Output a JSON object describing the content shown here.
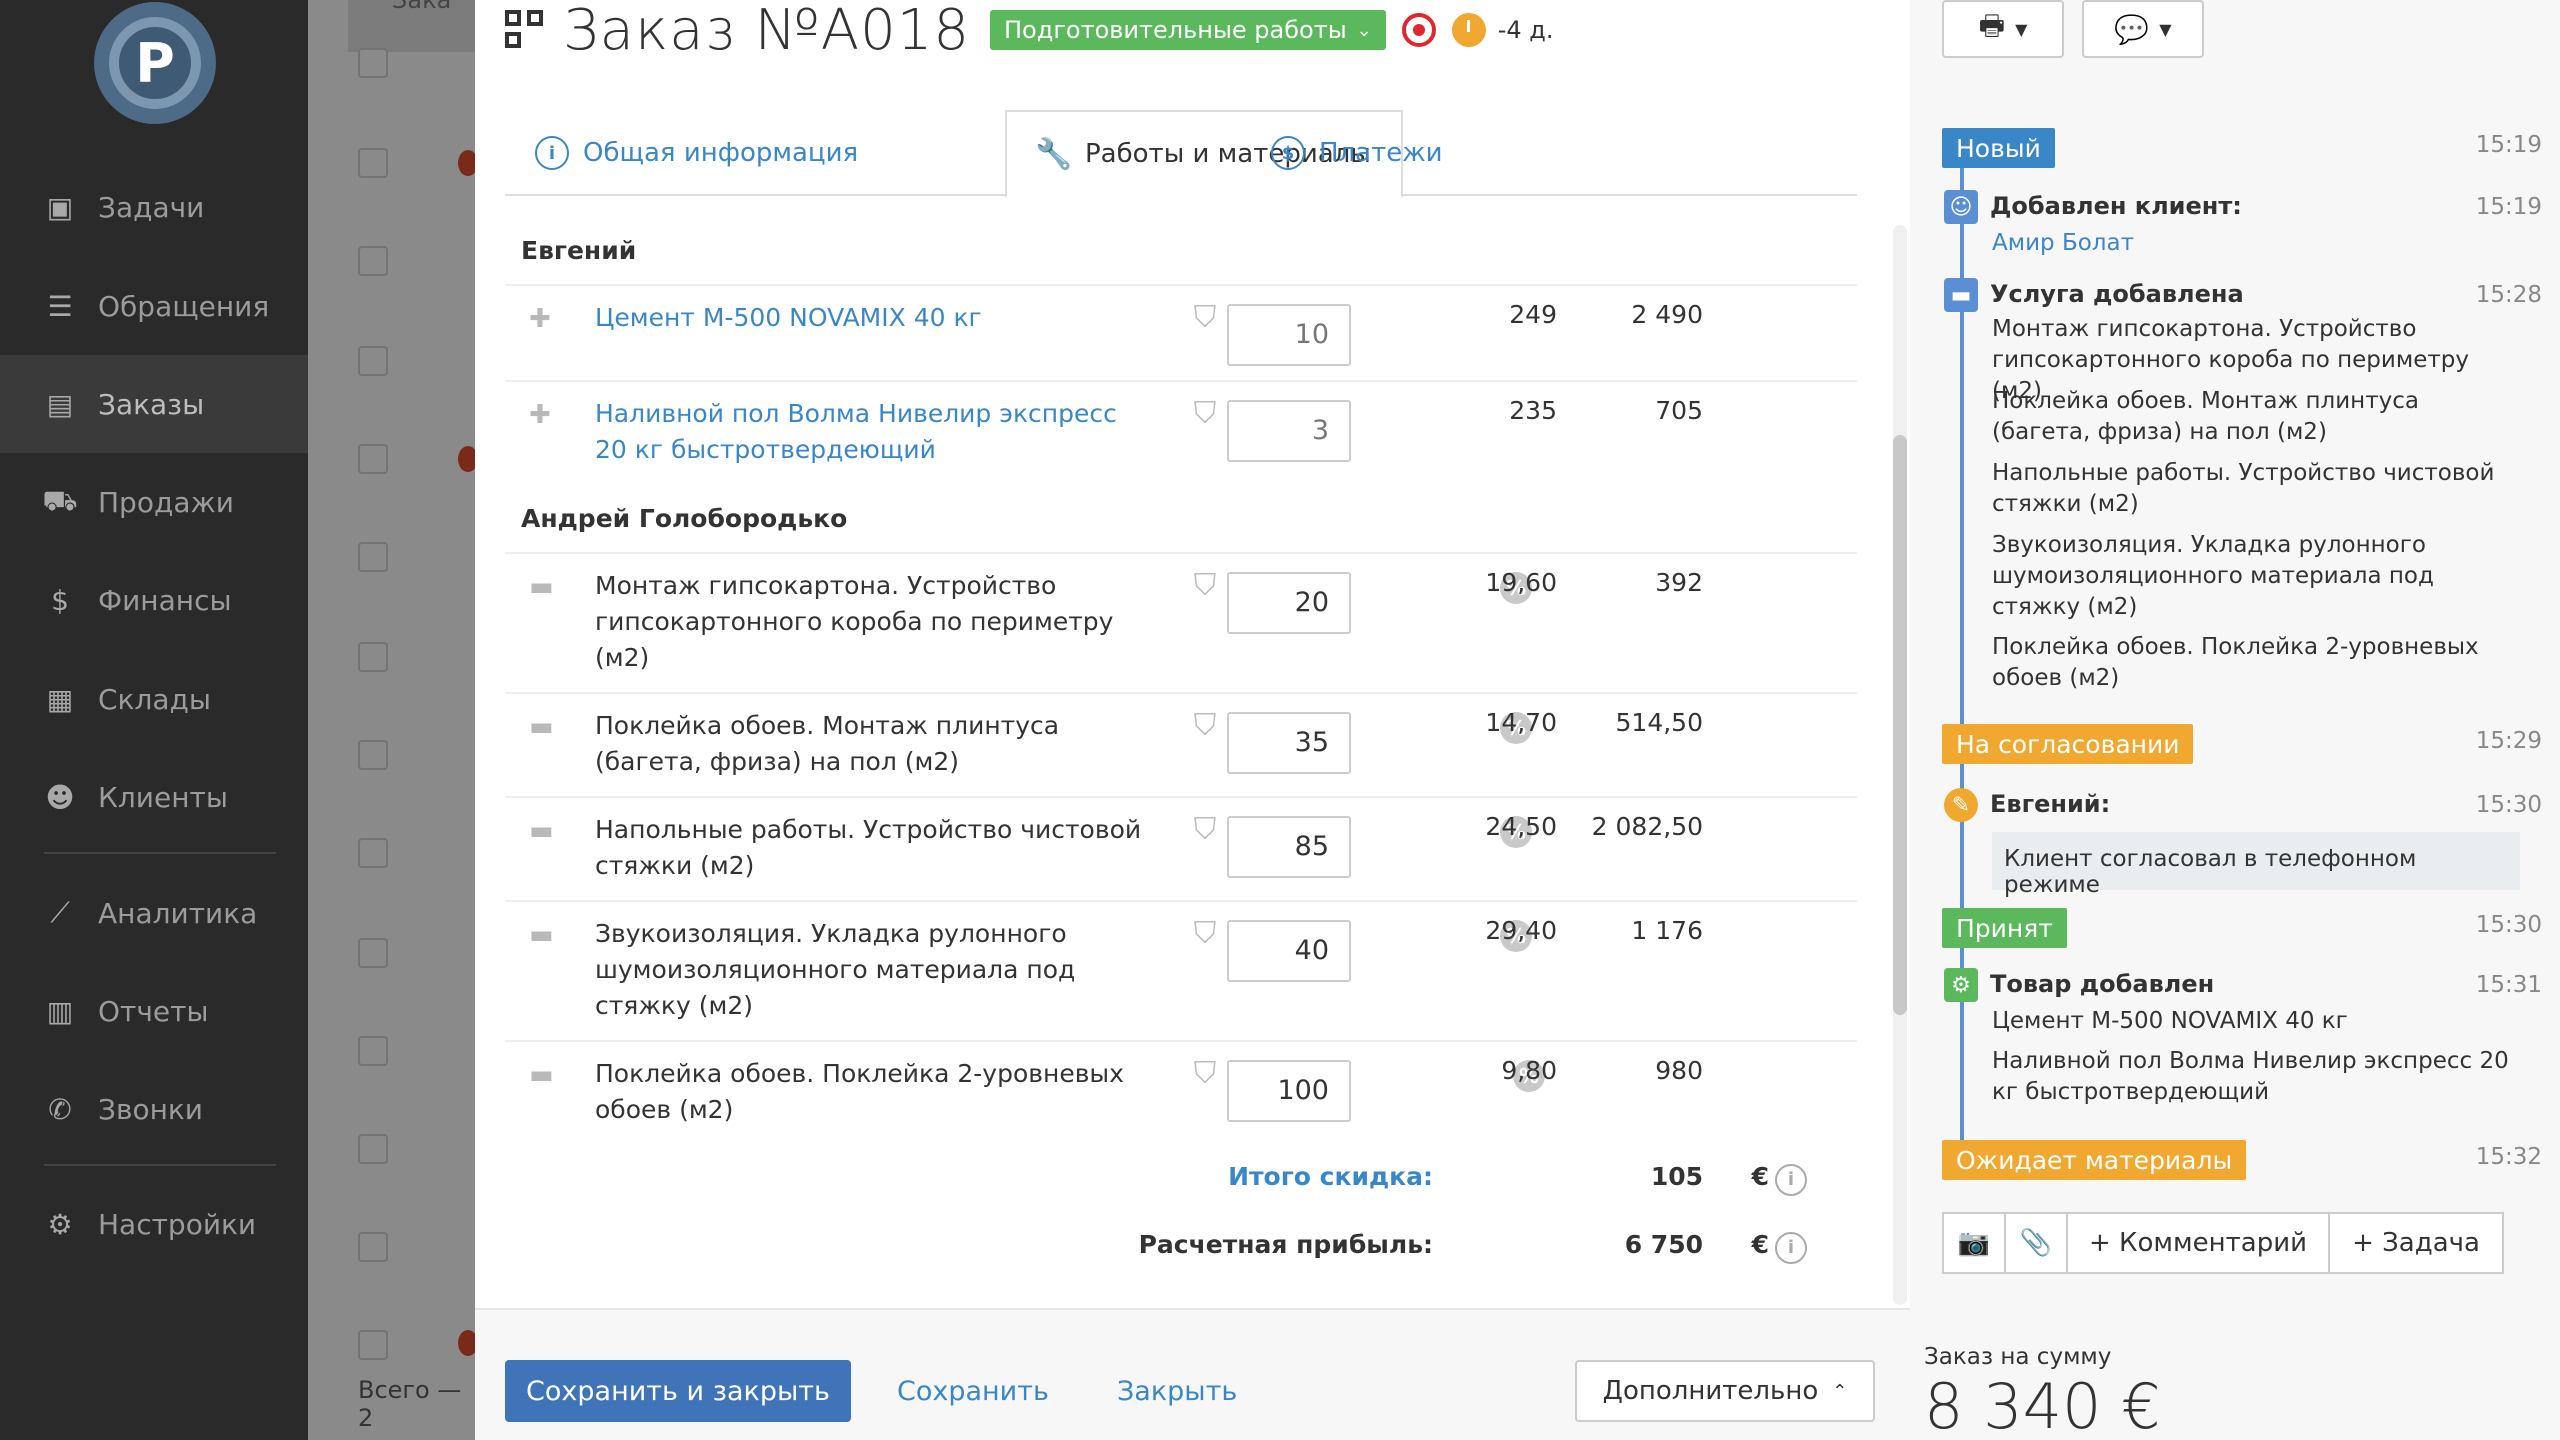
{
  "sidebar": {
    "logo": "P",
    "items": [
      {
        "icon": "clipboard-check-icon",
        "glyph": "▣",
        "label": "Задачи"
      },
      {
        "icon": "funnel-icon",
        "glyph": "☰",
        "label": "Обращения"
      },
      {
        "icon": "order-icon",
        "glyph": "▤",
        "label": "Заказы",
        "active": true
      },
      {
        "icon": "cart-icon",
        "glyph": "⛟",
        "label": "Продажи"
      },
      {
        "icon": "dollar-icon",
        "glyph": "$",
        "label": "Финансы"
      },
      {
        "icon": "boxes-icon",
        "glyph": "▦",
        "label": "Склады"
      },
      {
        "icon": "users-icon",
        "glyph": "☻",
        "label": "Клиенты"
      },
      {
        "icon": "chart-icon",
        "glyph": "⟋",
        "label": "Аналитика"
      },
      {
        "icon": "table-icon",
        "glyph": "▥",
        "label": "Отчеты"
      },
      {
        "icon": "phone-icon",
        "glyph": "✆",
        "label": "Звонки"
      },
      {
        "icon": "gear-icon",
        "glyph": "⚙",
        "label": "Настройки"
      }
    ]
  },
  "background_list": {
    "header_fragment": "Зака",
    "total_fragment": "Всего — 2"
  },
  "order": {
    "title": "Заказ №A018",
    "status": "Подготовительные работы",
    "status_color": "#5cb85c",
    "days_left": "-4 д."
  },
  "tabs": [
    {
      "icon": "info-icon",
      "glyph": "i",
      "label": "Общая информация"
    },
    {
      "icon": "wrench-icon",
      "glyph": "🔧",
      "label": "Работы и материалы",
      "active": true
    },
    {
      "icon": "dollar-circle-icon",
      "glyph": "$",
      "label": "Платежи"
    }
  ],
  "groups": [
    {
      "name": "Евгений",
      "rows": [
        {
          "type": "product",
          "name": "Цемент М-500 NOVAMIX 40 кг",
          "qty": "10",
          "discount": "",
          "price": "249",
          "sum": "2 490"
        },
        {
          "type": "product",
          "name": "Наливной пол Волма Нивелир экспресс 20 кг быстротвердеющий",
          "qty": "3",
          "discount": "",
          "price": "235",
          "sum": "705"
        }
      ]
    },
    {
      "name": "Андрей Голобородько",
      "rows": [
        {
          "type": "service",
          "name": "Монтаж гипсокартона. Устройство гипсокартонного короба по периметру (м2)",
          "qty": "20",
          "discount": "%",
          "price": "19,60",
          "sum": "392"
        },
        {
          "type": "service",
          "name": "Поклейка обоев. Монтаж плинтуса (багета, фриза) на пол (м2)",
          "qty": "35",
          "discount": "%",
          "price": "14,70",
          "sum": "514,50"
        },
        {
          "type": "service",
          "name": "Напольные работы. Устройство чистовой стяжки (м2)",
          "qty": "85",
          "discount": "%",
          "price": "24,50",
          "sum": "2 082,50"
        },
        {
          "type": "service",
          "name": "Звукоизоляция. Укладка рулонного шумоизоляционного материала под стяжку (м2)",
          "qty": "40",
          "discount": "%",
          "price": "29,40",
          "sum": "1 176"
        },
        {
          "type": "service",
          "name": "Поклейка обоев. Поклейка 2-уровневых обоев (м2)",
          "qty": "100",
          "discount": "%",
          "price": "9,80",
          "sum": "980"
        }
      ]
    }
  ],
  "totals": {
    "discount_label": "Итого скидка:",
    "discount_value": "105",
    "profit_label": "Расчетная прибыль:",
    "profit_value": "6 750",
    "currency": "€"
  },
  "footer": {
    "save_close": "Сохранить и закрыть",
    "save": "Сохранить",
    "close": "Закрыть",
    "more": "Дополнительно"
  },
  "right": {
    "print_icon": "printer-icon",
    "comment_icon": "chat-icon",
    "timeline": {
      "status_new": {
        "label": "Новый",
        "time": "15:19",
        "color": "#3a87c8"
      },
      "client_added": {
        "title": "Добавлен клиент:",
        "time": "15:19",
        "client": "Амир Болат"
      },
      "service_added": {
        "title": "Услуга добавлена",
        "time": "15:28",
        "items": [
          "Монтаж гипсокартона. Устройство гипсокартонного короба по периметру (м2)",
          "Поклейка обоев. Монтаж плинтуса (багета, фриза) на пол (м2)",
          "Напольные работы. Устройство чистовой стяжки (м2)",
          "Звукоизоляция. Укладка рулонного шумоизоляционного материала под стяжку (м2)",
          "Поклейка обоев. Поклейка 2-уровневых обоев (м2)"
        ]
      },
      "status_approval": {
        "label": "На согласовании",
        "time": "15:29",
        "color": "#f0a830"
      },
      "comment": {
        "author": "Евгений:",
        "time": "15:30",
        "text": "Клиент согласовал в телефонном режиме"
      },
      "status_accepted": {
        "label": "Принят",
        "time": "15:30",
        "color": "#5cb85c"
      },
      "product_added": {
        "title": "Товар добавлен",
        "time": "15:31",
        "items": [
          "Цемент М-500 NOVAMIX 40 кг",
          "Наливной пол Волма Нивелир экспресс 20 кг быстротвердеющий"
        ]
      },
      "status_waiting": {
        "label": "Ожидает материалы",
        "time": "15:32",
        "color": "#f0a830"
      }
    },
    "actions": {
      "camera_icon": "camera-icon",
      "attach_icon": "paperclip-icon",
      "comment": "+ Комментарий",
      "task": "+ Задача"
    },
    "sum_label": "Заказ на сумму",
    "sum_value": "8 340 €"
  }
}
